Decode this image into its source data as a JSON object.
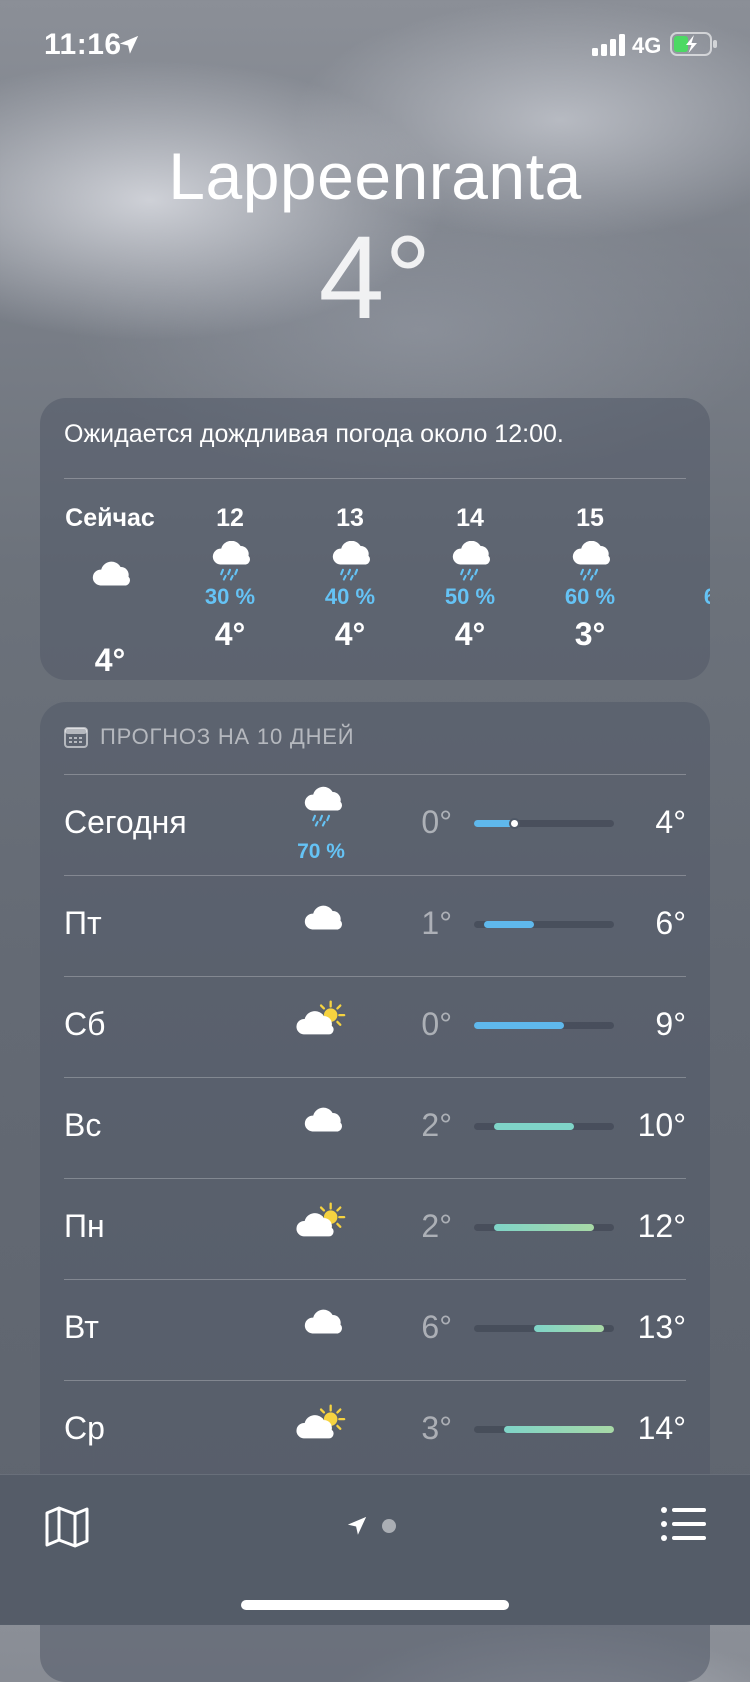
{
  "status_bar": {
    "time": "11:16",
    "network": "4G"
  },
  "location": {
    "city": "Lappeenranta",
    "current_temp": "4°"
  },
  "hourly": {
    "description": "Ожидается дождливая погода около 12:00.",
    "items": [
      {
        "label": "Сейчас",
        "icon": "cloud-icon",
        "pop": "",
        "temp": "4°"
      },
      {
        "label": "12",
        "icon": "rain-icon",
        "pop": "30 %",
        "temp": "4°"
      },
      {
        "label": "13",
        "icon": "rain-icon",
        "pop": "40 %",
        "temp": "4°"
      },
      {
        "label": "14",
        "icon": "rain-icon",
        "pop": "50 %",
        "temp": "4°"
      },
      {
        "label": "15",
        "icon": "rain-icon",
        "pop": "60 %",
        "temp": "3°"
      },
      {
        "label": "",
        "icon": "",
        "pop": "6",
        "temp": ""
      }
    ]
  },
  "daily": {
    "header": "ПРОГНОЗ НА 10 ДНЕЙ",
    "range": {
      "min": 0,
      "max": 14
    },
    "current_temp_value": 4,
    "days": [
      {
        "name": "Сегодня",
        "icon": "rain-icon",
        "pop": "70 %",
        "low": "0°",
        "high": "4°",
        "low_value": 0,
        "high_value": 4
      },
      {
        "name": "Пт",
        "icon": "cloud-icon",
        "pop": "",
        "low": "1°",
        "high": "6°",
        "low_value": 1,
        "high_value": 6
      },
      {
        "name": "Сб",
        "icon": "partly-sunny-icon",
        "pop": "",
        "low": "0°",
        "high": "9°",
        "low_value": 0,
        "high_value": 9
      },
      {
        "name": "Вс",
        "icon": "cloud-icon",
        "pop": "",
        "low": "2°",
        "high": "10°",
        "low_value": 2,
        "high_value": 10
      },
      {
        "name": "Пн",
        "icon": "partly-sunny-icon",
        "pop": "",
        "low": "2°",
        "high": "12°",
        "low_value": 2,
        "high_value": 12
      },
      {
        "name": "Вт",
        "icon": "cloud-icon",
        "pop": "",
        "low": "6°",
        "high": "13°",
        "low_value": 6,
        "high_value": 13
      },
      {
        "name": "Ср",
        "icon": "partly-sunny-icon",
        "pop": "",
        "low": "3°",
        "high": "14°",
        "low_value": 3,
        "high_value": 14
      }
    ]
  },
  "toolbar": {
    "left_icon": "map-icon",
    "right_icon": "list-icon",
    "page_indicator_icon": "location-arrow-icon"
  },
  "colors": {
    "precip": "#65c3f5",
    "bar_cold": "#5fb8ec",
    "bar_mild": "#7fd4c8",
    "bar_warm": "#a8d9a6",
    "sun": "#f6d340"
  }
}
